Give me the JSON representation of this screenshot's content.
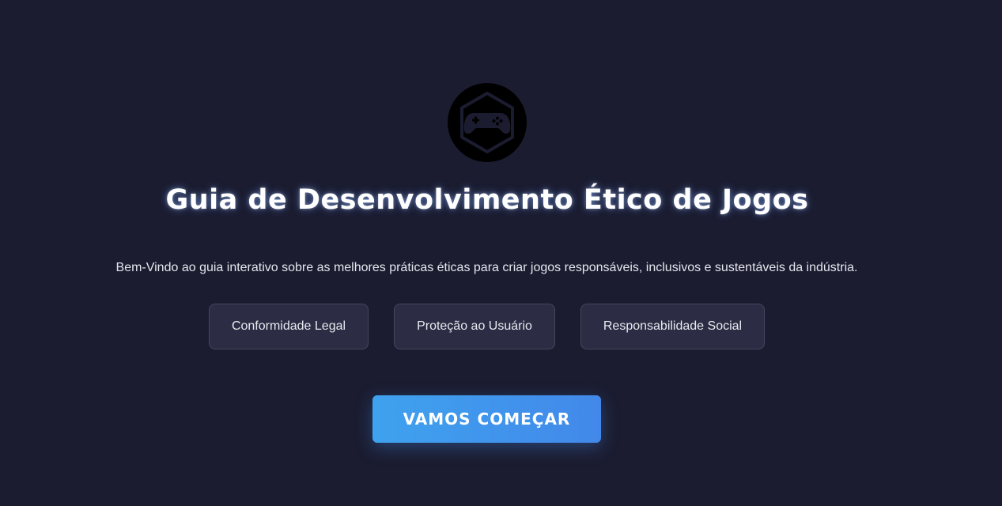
{
  "logo": {
    "icon": "gamepad-icon",
    "background": "#000000"
  },
  "hero": {
    "title": "Guia de Desenvolvimento Ético de Jogos",
    "subtitle": "Bem-Vindo ao guia interativo sobre as melhores práticas éticas para criar jogos responsáveis, inclusivos e sustentáveis da indústria."
  },
  "topics": [
    {
      "label": "Conformidade Legal"
    },
    {
      "label": "Proteção ao Usuário"
    },
    {
      "label": "Responsabilidade Social"
    }
  ],
  "cta": {
    "label": "VAMOS COMEÇAR",
    "color_start": "#3fa2ee",
    "color_end": "#4288ea"
  },
  "theme": {
    "background": "#1b1c30",
    "pill_background": "#2c2d44"
  }
}
